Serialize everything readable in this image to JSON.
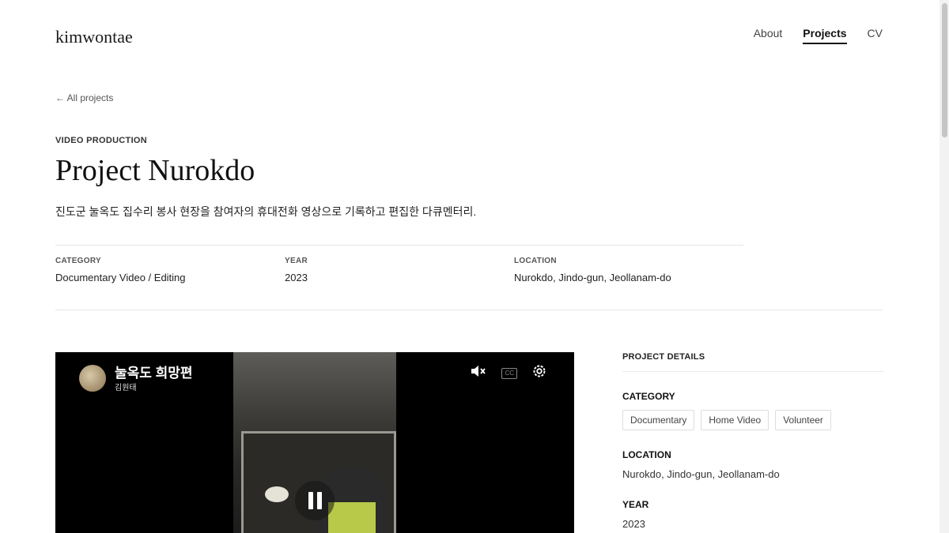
{
  "header": {
    "logo": "kimwontae",
    "nav": [
      {
        "label": "About"
      },
      {
        "label": "Projects"
      },
      {
        "label": "CV"
      }
    ]
  },
  "back_link": "← All projects",
  "project": {
    "kicker": "VIDEO PRODUCTION",
    "title": "Project Nurokdo",
    "description": "진도군 눌옥도 집수리 봉사 현장을 참여자의 휴대전화 영상으로 기록하고 편집한 다큐멘터리.",
    "meta": [
      {
        "label": "CATEGORY",
        "value": "Documentary Video / Editing"
      },
      {
        "label": "YEAR",
        "value": "2023"
      },
      {
        "label": "LOCATION",
        "value": "Nurokdo, Jindo-gun, Jeollanam-do"
      }
    ]
  },
  "video": {
    "title": "눌옥도 희망편",
    "channel": "김원태",
    "cc_label": "CC",
    "icons": [
      "mute-icon",
      "captions-icon",
      "settings-gear-icon",
      "pause-icon"
    ]
  },
  "details": {
    "heading": "PROJECT DETAILS",
    "category_label": "CATEGORY",
    "tags": [
      "Documentary",
      "Home Video",
      "Volunteer"
    ],
    "location_label": "LOCATION",
    "location": "Nurokdo, Jindo-gun, Jeollanam-do",
    "year_label": "YEAR",
    "year": "2023"
  }
}
